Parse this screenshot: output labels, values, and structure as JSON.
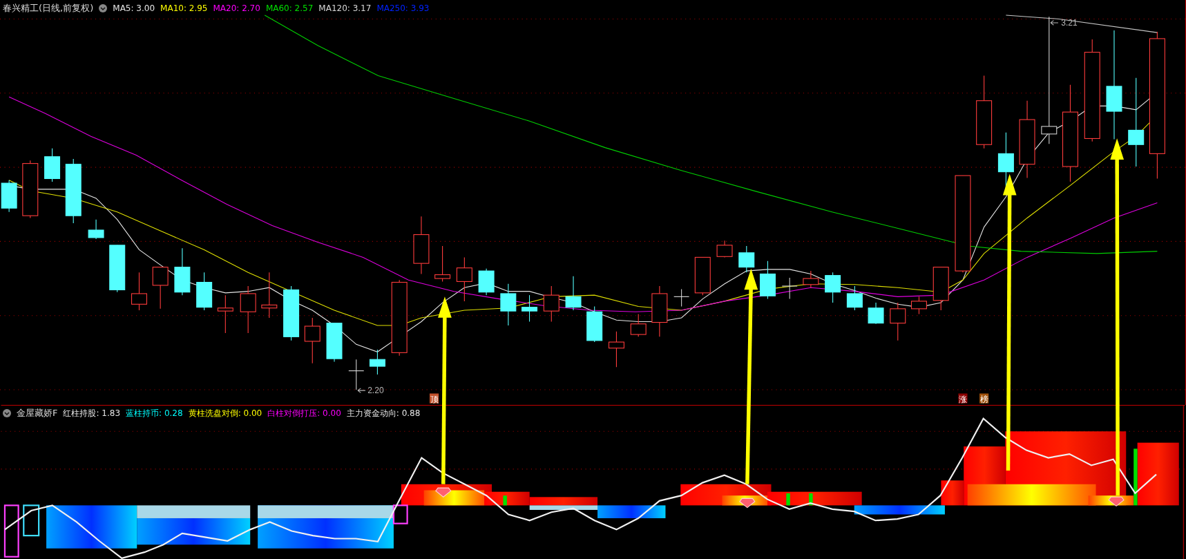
{
  "main_chart": {
    "title": "春兴精工(日线,前复权)",
    "moving_averages": [
      {
        "label": "MA5:",
        "value": "3.00",
        "color": "#e6e6e6"
      },
      {
        "label": "MA10:",
        "value": "2.95",
        "color": "#ffff00"
      },
      {
        "label": "MA20:",
        "value": "2.70",
        "color": "#ff00ff"
      },
      {
        "label": "MA60:",
        "value": "2.57",
        "color": "#00e000"
      },
      {
        "label": "MA120:",
        "value": "3.17",
        "color": "#d8d8d8"
      },
      {
        "label": "MA250:",
        "value": "3.93",
        "color": "#0022ff"
      }
    ],
    "price_labels": [
      {
        "kind": "high",
        "text": "3.21"
      },
      {
        "kind": "low",
        "text": "2.20"
      }
    ],
    "signal_tags": [
      {
        "text": "顶",
        "color": "#c0502a"
      },
      {
        "text": "涨",
        "color": "#8b0000"
      },
      {
        "text": "榜",
        "color": "#a0520c"
      }
    ]
  },
  "indicator": {
    "name": "金屋藏娇F",
    "readings": [
      {
        "label": "红柱持股:",
        "value": "1.83",
        "color": "#e6e6e6"
      },
      {
        "label": "蓝柱持币:",
        "value": "0.28",
        "color": "#00ffff"
      },
      {
        "label": "黄柱洗盘对倒:",
        "value": "0.00",
        "color": "#ffff00"
      },
      {
        "label": "白柱对倒打压:",
        "value": "0.00",
        "color": "#ff00ff"
      },
      {
        "label": "主力资金动向:",
        "value": "0.88",
        "color": "#e6e6e6"
      }
    ]
  }
}
